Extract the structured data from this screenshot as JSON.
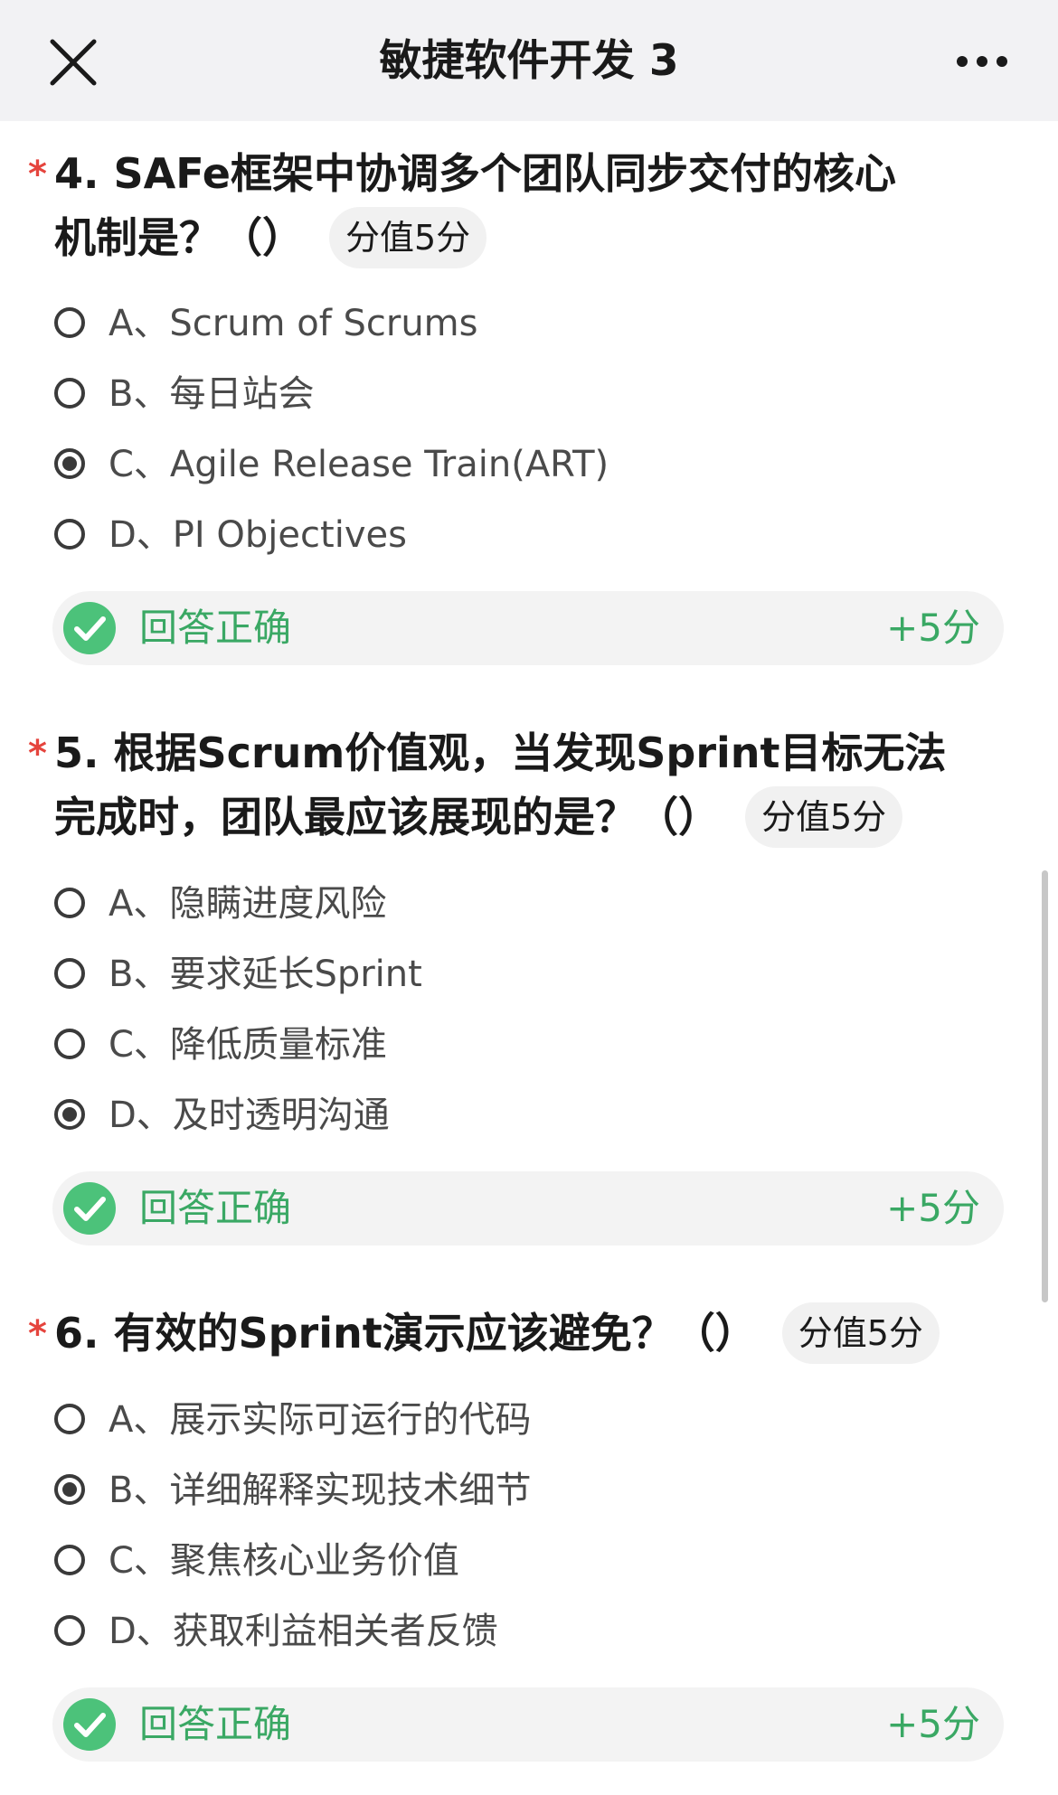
{
  "header": {
    "title": "敏捷软件开发 3",
    "close_icon": "close-icon",
    "more_icon": "more-horizontal-icon"
  },
  "required_mark": "*",
  "questions": [
    {
      "title": "4. SAFe框架中协调多个团队同步交付的核心机制是？（）",
      "title_line1": "4. SAFe框架中协调多个团队同步交付的核心",
      "title_line2": "机制是？（）",
      "score": "分值5分",
      "options": [
        {
          "label": "A、Scrum of Scrums",
          "selected": false
        },
        {
          "label": "B、每日站会",
          "selected": false
        },
        {
          "label": "C、Agile Release Train(ART)",
          "selected": true
        },
        {
          "label": "D、PI Objectives",
          "selected": false
        }
      ],
      "result": {
        "text": "回答正确",
        "points": "+5分"
      }
    },
    {
      "title": "5. 根据Scrum价值观，当发现Sprint目标无法完成时，团队最应该展现的是？（）",
      "title_line1": "5. 根据Scrum价值观，当发现Sprint目标无法",
      "title_line2": "完成时，团队最应该展现的是？（）",
      "score": "分值5分",
      "options": [
        {
          "label": "A、隐瞒进度风险",
          "selected": false
        },
        {
          "label": "B、要求延长Sprint",
          "selected": false
        },
        {
          "label": "C、降低质量标准",
          "selected": false
        },
        {
          "label": "D、及时透明沟通",
          "selected": true
        }
      ],
      "result": {
        "text": "回答正确",
        "points": "+5分"
      }
    },
    {
      "title": "6. 有效的Sprint演示应该避免？（）",
      "title_line1": "6. 有效的Sprint演示应该避免？（）",
      "score": "分值5分",
      "options": [
        {
          "label": "A、展示实际可运行的代码",
          "selected": false
        },
        {
          "label": "B、详细解释实现技术细节",
          "selected": true
        },
        {
          "label": "C、聚焦核心业务价值",
          "selected": false
        },
        {
          "label": "D、获取利益相关者反馈",
          "selected": false
        }
      ],
      "result": {
        "text": "回答正确",
        "points": "+5分"
      }
    }
  ],
  "colors": {
    "header_bg": "#f2f2f4",
    "required_red": "#e5443d",
    "correct_green": "#3aa864",
    "result_bg": "#f3f3f3"
  }
}
